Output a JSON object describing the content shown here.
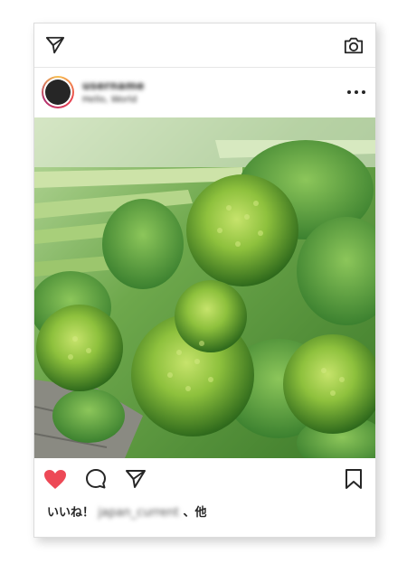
{
  "header": {
    "send_icon": "paper-plane-icon",
    "camera_icon": "camera-icon"
  },
  "post": {
    "username": "username",
    "location": "Hello, World",
    "image_description": "",
    "likes_prefix": "いいね！",
    "liked_by": "japan_current",
    "likes_suffix": "、他"
  },
  "actions": {
    "like_icon": "heart-icon",
    "comment_icon": "comment-icon",
    "share_icon": "send-icon",
    "save_icon": "bookmark-icon"
  },
  "colors": {
    "like": "#ed4956",
    "text": "#262626",
    "border": "#dcdcdc"
  }
}
